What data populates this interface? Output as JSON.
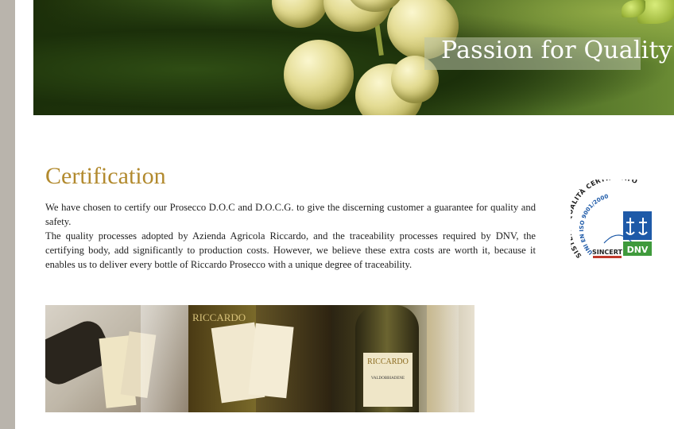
{
  "hero": {
    "tagline": "Passion for Quality",
    "image_desc": "white-grapes-photo"
  },
  "certification": {
    "title": "Certification",
    "paragraph_1": "We have chosen to certify our Prosecco D.O.C and D.O.C.G. to give the discerning customer a guarantee for quality and safety.",
    "paragraph_2": "The quality processes adopted by Azienda Agricola Riccardo, and the traceability processes required by DNV, the certifying body, add significantly to production costs. However, we believe these extra costs are worth it, because it enables us to deliver every bottle of Riccardo Prosecco with a unique degree of traceability."
  },
  "seal": {
    "arc_text": "SISTEMA QUALITÀ CERTIFICATO",
    "iso_text": "UNI EN ISO 9001/2000",
    "sincert_label": "SINCERT",
    "dnv_label": "DNV",
    "colors": {
      "blue": "#1e5aa8",
      "green": "#3f9a3c"
    }
  },
  "gallery": {
    "label_1": "RICCARDO",
    "label_2": "RICCARDO",
    "label_3": "VALDOBBIADENE"
  },
  "colors": {
    "title": "#b28a2e",
    "sidebar": "#b9b4ac"
  }
}
